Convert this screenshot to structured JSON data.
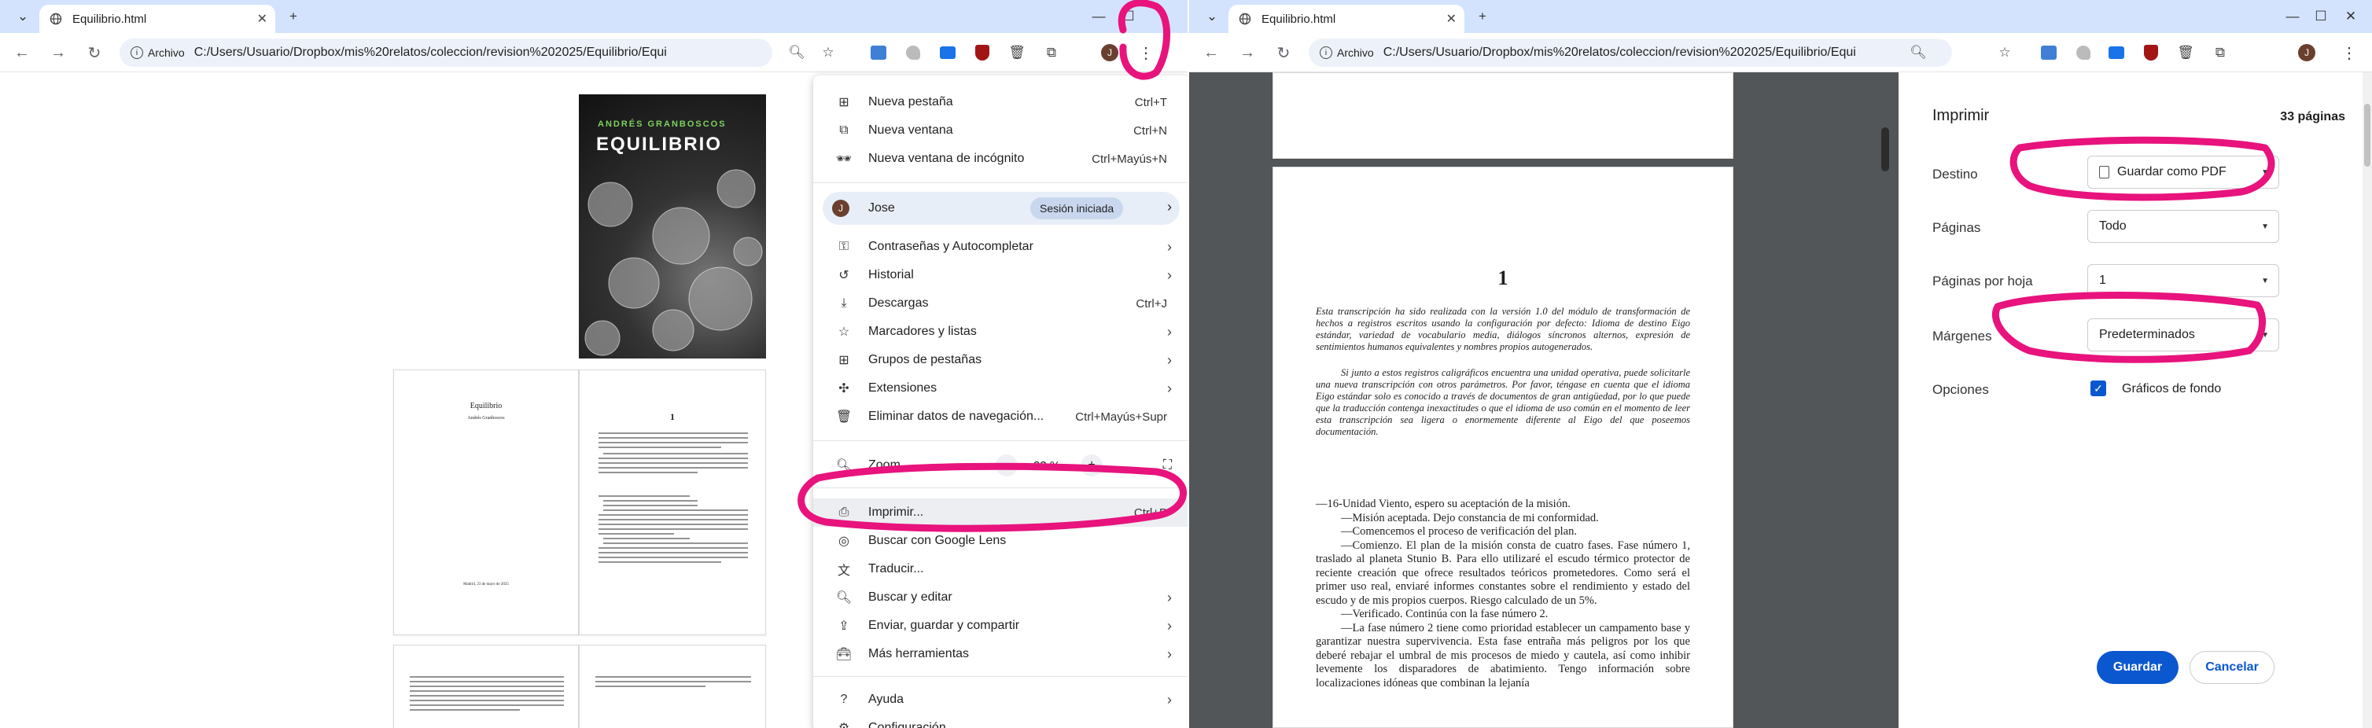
{
  "left": {
    "tab_title": "Equilibrio.html",
    "url_chip": "Archivo",
    "url": "C:/Users/Usuario/Dropbox/mis%20relatos/coleccion/revision%202025/Equilibrio/Equilibri...",
    "avatar_letter": "J",
    "cover": {
      "author": "ANDRÉS GRANBOSCOS",
      "title": "EQUILIBRIO"
    },
    "title_page": {
      "title": "Equilibrio",
      "author": "Andrés Granboscos",
      "footer": "Madrid, 23 de mayo de 2025"
    },
    "page_number": "1",
    "menu": {
      "new_tab": {
        "label": "Nueva pestaña",
        "shortcut": "Ctrl+T"
      },
      "new_window": {
        "label": "Nueva ventana",
        "shortcut": "Ctrl+N"
      },
      "incognito": {
        "label": "Nueva ventana de incógnito",
        "shortcut": "Ctrl+Mayús+N"
      },
      "profile": {
        "name": "Jose",
        "status": "Sesión iniciada"
      },
      "passwords": "Contraseñas y Autocompletar",
      "history": "Historial",
      "downloads": {
        "label": "Descargas",
        "shortcut": "Ctrl+J"
      },
      "bookmarks": "Marcadores y listas",
      "tab_groups": "Grupos de pestañas",
      "extensions": "Extensiones",
      "clear_data": {
        "label": "Eliminar datos de navegación...",
        "shortcut": "Ctrl+Mayús+Supr"
      },
      "zoom": {
        "label": "Zoom",
        "minus": "−",
        "value": "33 %",
        "plus": "+"
      },
      "print": {
        "label": "Imprimir...",
        "shortcut": "Ctrl+P"
      },
      "lens": "Buscar con Google Lens",
      "translate": "Traducir...",
      "find_edit": "Buscar y editar",
      "save_share": "Enviar, guardar y compartir",
      "more_tools": "Más herramientas",
      "help": "Ayuda",
      "settings": "Configuración"
    }
  },
  "right": {
    "tab_title": "Equilibrio.html",
    "url_chip": "Archivo",
    "url": "C:/Users/Usuario/Dropbox/mis%20relatos/coleccion/revision%202025/Equilibrio/Equilibri...",
    "avatar_letter": "J",
    "preview": {
      "page_number": "1",
      "intro": "Esta transcripción ha sido realizada con la versión 1.0 del módulo de transformación de hechos a registros escritos usando la configuración por defecto: Idioma de destino Eigo estándar, variedad de vocabulario media, diálogos síncronos alternos, expresión de sentimientos humanos equivalentes y nombres propios autogenerados.",
      "intro2": "Si junto a estos registros caligráficos encuentra una unidad operativa, puede solicitarle una nueva transcripción con otros parámetros. Por favor, téngase en cuenta que el idioma Eigo estándar solo es conocido a través de documentos de gran antigüedad, por lo que puede que la traducción contenga inexactitudes o que el idioma de uso común en el momento de leer esta transcripción sea ligera o enormemente diferente al Eigo del que poseemos documentación.",
      "body": [
        "—16-Unidad Viento, espero su aceptación de la misión.",
        "—Misión aceptada. Dejo constancia de mi conformidad.",
        "—Comencemos el proceso de verificación del plan.",
        "—Comienzo. El plan de la misión consta de cuatro fases. Fase número 1, traslado al planeta Stunio B. Para ello utilizaré el escudo térmico protector de reciente creación que ofrece resultados teóricos prometedores. Como será el primer uso real, enviaré informes constantes sobre el rendimiento y estado del escudo y de mis propios cuerpos. Riesgo calculado de un 5%.",
        "—Verificado. Continúa con la fase número 2.",
        "—La fase número 2 tiene como prioridad establecer un campamento base y garantizar nuestra supervivencia. Esta fase entraña más peligros por los que deberé rebajar el umbral de mis procesos de miedo y cautela, así como inhibir levemente los disparadores de abatimiento. Tengo información sobre localizaciones idóneas que combinan la lejanía"
      ]
    },
    "print": {
      "title": "Imprimir",
      "pages_count": "33 páginas",
      "dest_label": "Destino",
      "dest_value": "Guardar como PDF",
      "pages_label": "Páginas",
      "pages_value": "Todo",
      "pps_label": "Páginas por hoja",
      "pps_value": "1",
      "margins_label": "Márgenes",
      "margins_value": "Predeterminados",
      "options_label": "Opciones",
      "bg_label": "Gráficos de fondo",
      "save_button": "Guardar",
      "cancel_button": "Cancelar"
    }
  },
  "colors": {
    "accent": "#0b57d0",
    "tabstrip": "#d3e3fd",
    "annotation": "#e8137d",
    "preview_bg": "#525659"
  }
}
